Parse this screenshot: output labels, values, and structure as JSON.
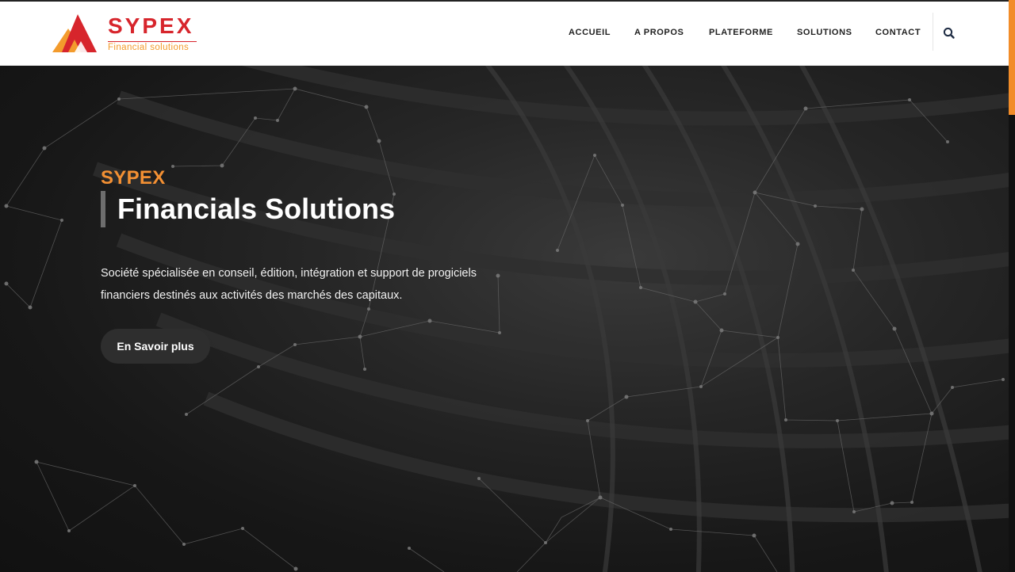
{
  "brand": {
    "name": "SYPEX",
    "tagline": "Financial solutions",
    "colors": {
      "red": "#d7252c",
      "orange": "#f39b2c",
      "accent": "#f39033"
    }
  },
  "nav": {
    "items": [
      {
        "label": "ACCUEIL"
      },
      {
        "label": "A PROPOS"
      },
      {
        "label": "PLATEFORME"
      },
      {
        "label": "SOLUTIONS"
      },
      {
        "label": "CONTACT"
      }
    ],
    "search_icon": "search-icon"
  },
  "hero": {
    "kicker": "SYPEX",
    "title": "Financials Solutions",
    "description": "Société spécialisée en conseil, édition, intégration et support de progiciels financiers destinés aux activités des marchés des capitaux.",
    "cta_label": "En Savoir plus"
  }
}
